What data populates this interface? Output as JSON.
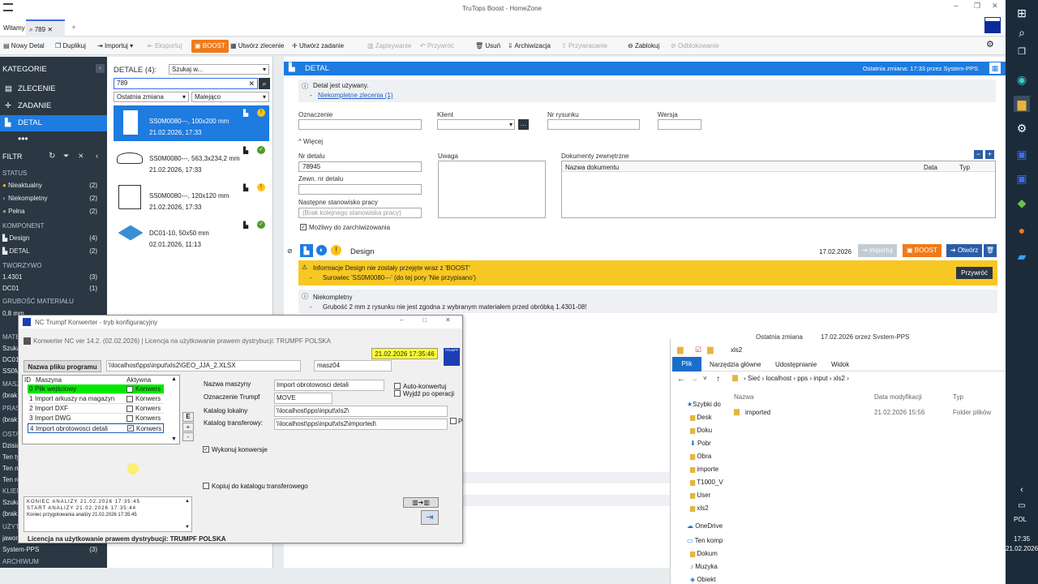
{
  "window": {
    "title": "TruTops Boost - HomeZone"
  },
  "tabs": [
    {
      "label": "Witamy"
    },
    {
      "label": "789"
    }
  ],
  "toolbar": {
    "new": "Nowy Detal",
    "duplicate": "Duplikuj",
    "import": "Importuj",
    "export": "Eksportuj",
    "boost": "BOOST",
    "create_order": "Utwórz zlecenie",
    "create_task": "Utwórz zadanie",
    "save": "Zapisywanie",
    "restore": "Przywróć",
    "delete": "Usuń",
    "archive": "Archiwizacja",
    "unarchive": "Przywracanie",
    "lock": "Zablokuj",
    "unlock": "Odblokowanie"
  },
  "sidebar": {
    "title": "KATEGORIE",
    "nav": [
      {
        "label": "ZLECENIE"
      },
      {
        "label": "ZADANIE"
      },
      {
        "label": "DETAL"
      }
    ],
    "filter_title": "FILTR",
    "status_header": "STATUS",
    "status": [
      {
        "label": "Nieaktualny",
        "count": "(2)"
      },
      {
        "label": "Niekompletny",
        "count": "(2)"
      },
      {
        "label": "Pełna",
        "count": "(2)"
      }
    ],
    "component_header": "KOMPONENT",
    "components": [
      {
        "label": "Design",
        "count": "(4)"
      },
      {
        "label": "DETAL",
        "count": "(2)"
      }
    ],
    "material_header": "TWORZYWO",
    "materials": [
      {
        "label": "1.4301",
        "count": "(3)"
      },
      {
        "label": "DC01",
        "count": "(1)"
      }
    ],
    "thickness_header": "GRUBOŚĆ MATERIAŁU",
    "thickness_first": "0,8 mm",
    "stubs": [
      "MATE",
      "Szuka",
      "DC01",
      "SS0M",
      "MASZ",
      "(brak",
      "PRAS",
      "(brak",
      "OSTA",
      "Dzisia",
      "Ten ty",
      "Ten m",
      "Ten ro",
      "KLIEN",
      "Szuka",
      "(brak",
      "UŻYT",
      "jawor"
    ],
    "user_row": {
      "label": "System-PPS",
      "count": "(3)"
    },
    "archive_header": "ARCHIWUM"
  },
  "list": {
    "header": "DETALE (4):",
    "search_scope": "Szukaj w...",
    "search_value": "789",
    "sort_field": "Ostatnia zmiana",
    "sort_order": "Malejąco",
    "items": [
      {
        "name": "SS0M0080---, 100x200 mm",
        "date": "21.02.2026, 17:33"
      },
      {
        "name": "SS0M0080---, 563,3x234,2 mm",
        "date": "21.02.2026, 17:33"
      },
      {
        "name": "SS0M0080---, 120x120 mm",
        "date": "21.02.2026, 17:33"
      },
      {
        "name": "DC01-10, 50x50 mm",
        "date": "02.01.2026, 11:13"
      }
    ]
  },
  "detail": {
    "header": "DETAL",
    "last_change": "Ostatnia zmiana: 17:33 przez System-PPS",
    "info_used": "Detal jest używany.",
    "info_link": "Niekompletne zlecenia (1)",
    "labels": {
      "oznaczenie": "Oznaczenie",
      "klient": "Klient",
      "nr_rysunku": "Nr rysunku",
      "wersja": "Wersja",
      "wiecej": "Więcej",
      "nr_detalu": "Nr detalu",
      "zewn_nr": "Zewn. nr detalu",
      "nastepne": "Następne stanowisko pracy",
      "archiwizacja": "Możliwy do zarchiwizowania",
      "uwaga": "Uwaga",
      "dokumenty": "Dokumenty zewnętrzne",
      "nazwa_dok": "Nazwa dokumentu",
      "data": "Data",
      "typ": "Typ"
    },
    "nr_detalu_value": "78945",
    "nastepne_placeholder": "(Brak kolejnego stanowiska pracy)",
    "design": {
      "title": "Design",
      "date": "17.02.2026",
      "import": "Importuj",
      "boost": "BOOST",
      "open": "Otwórz",
      "warn_title": "Informacje Design nie zostały przejęte wraz z 'BOOST'",
      "warn_item": "Surowiec 'SS0M0080---' (do tej pory 'Nie przypisano')",
      "restore": "Przywróć",
      "incomplete_title": "Niekompletny",
      "incomplete_item": "Grubość 2 mm z rysunku nie jest zgodna z wybranym materiałem przed obróbką 1.4301-08!"
    },
    "bottom_last_change_label": "Ostatnia zmiana",
    "bottom_last_change_value": "17.02.2026 przez System-PPS"
  },
  "converter": {
    "title": "NC Trumpf Konwerter - tryb konfiguracyjny",
    "subtitle": "Konwerter NC ver 14.2. (02.02.2026) | Licencja na użytkowanie prawem dystrybucji: TRUMPF POLSKA",
    "filename_label": "Nazwa pliku programu",
    "filename_value": "\\\\localhost\\pps\\input\\xls2\\GEO_JJA_2.XLSX",
    "machine_code": "masz04",
    "datetime": "21.02.2026 17:35:46",
    "logo": "TRUMPF",
    "grid_headers": {
      "id": "ID",
      "machine": "Maszyna",
      "active": "Aktywna"
    },
    "rows": [
      {
        "id": "0",
        "name": "Plik wejściowy",
        "active": "Konwers"
      },
      {
        "id": "1",
        "name": "Import arkuszy na magazyn",
        "active": "Konwers"
      },
      {
        "id": "2",
        "name": "Import DXF",
        "active": "Konwers"
      },
      {
        "id": "3",
        "name": "Import DWG",
        "active": "Konwers"
      },
      {
        "id": "4",
        "name": "Import obrotowosci detali",
        "active": "Konwers"
      }
    ],
    "side_buttons": [
      "E",
      "+",
      "-"
    ],
    "labels": {
      "machine": "Nazwa maszyny",
      "trumpf": "Oznaczenie Trumpf",
      "local": "Katalog lokalny",
      "transfer": "Katalog transferowy:"
    },
    "values": {
      "machine": "Import obrotowosci detali",
      "trumpf": "MOVE",
      "local": "\\\\localhost\\pps\\input\\xls2\\",
      "transfer": "\\\\localhost\\pps\\input\\xls2\\imported\\"
    },
    "auto_convert": "Auto-konwertuj",
    "exit_after": "Wyjdź po operacji",
    "run_convert": "Wykonuj konwersje",
    "copy_transfer": "Kopiuj do katalogu transferowego",
    "p_label": "P",
    "log": [
      "KONIEC ANALIZY 21.02.2026 17:35:45",
      "START ANALIZY 21.02.2026 17:35:44",
      "Koniec przygotowania analizy 21.02.2026 17:35:45"
    ],
    "license": "Licencja na użytkowanie prawem dystrybucji: TRUMPF POLSKA"
  },
  "explorer": {
    "title": "xls2",
    "ribbon": [
      "Plik",
      "Narzędzia główne",
      "Udostępnianie",
      "Widok"
    ],
    "path": [
      "Sieć",
      "localhost",
      "pps",
      "input",
      "xls2"
    ],
    "columns": {
      "name": "Nazwa",
      "date": "Data modyfikacji",
      "type": "Typ"
    },
    "files": [
      {
        "name": "imported",
        "date": "21.02.2026 15:56",
        "type": "Folder plików"
      }
    ],
    "nav": [
      "Szybki do",
      "Desk",
      "Doku",
      "Pobr",
      "Obra",
      "importe",
      "T1000_V",
      "User",
      "xls2",
      "OneDrive",
      "Ten komp",
      "Dokum",
      "Muzyka",
      "Obiekt"
    ]
  },
  "system": {
    "lang": "POL",
    "time": "17:35",
    "date": "21.02.2026"
  }
}
